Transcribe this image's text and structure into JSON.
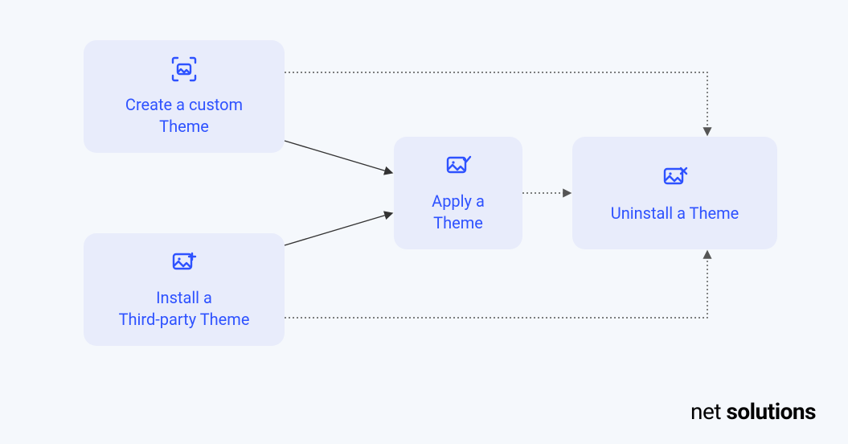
{
  "nodes": {
    "create": {
      "label": "Create a custom\nTheme",
      "icon": "image-scan-icon"
    },
    "install": {
      "label": "Install a\nThird-party Theme",
      "icon": "image-plus-icon"
    },
    "apply": {
      "label": "Apply a\nTheme",
      "icon": "image-check-icon"
    },
    "uninstall": {
      "label": "Uninstall a Theme",
      "icon": "image-x-icon"
    }
  },
  "brand": {
    "part1": "net ",
    "part2": "solutions"
  },
  "colors": {
    "nodeBg": "#e8ecfb",
    "accent": "#2e52ff",
    "pageBg": "#f5f8fc"
  }
}
